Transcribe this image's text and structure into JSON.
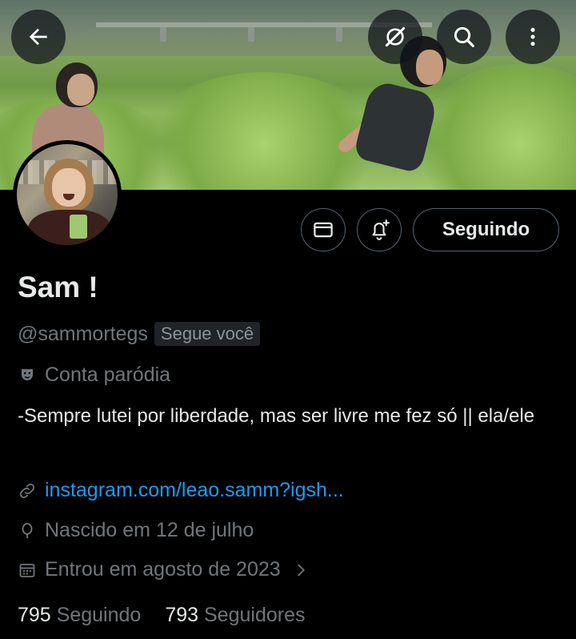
{
  "header": {
    "back_icon": "arrow-left-icon",
    "grok_icon": "grok-slash-icon",
    "search_icon": "search-icon",
    "more_icon": "more-vertical-icon"
  },
  "actions": {
    "message_icon": "envelope-icon",
    "notify_icon": "bell-plus-icon",
    "following_label": "Seguindo"
  },
  "profile": {
    "name": "Sam !",
    "handle": "@sammortegs",
    "follows_you": "Segue você",
    "parody_label": "Conta paródia",
    "bio": "-Sempre lutei por liberdade, mas ser livre me fez só || ela/ele",
    "link": "instagram.com/leao.samm?igsh...",
    "born": "Nascido em 12 de julho",
    "joined": "Entrou em agosto de 2023"
  },
  "stats": {
    "following_count": "795",
    "following_label": "Seguindo",
    "followers_count": "793",
    "followers_label": "Seguidores"
  },
  "colors": {
    "background": "#000000",
    "text_primary": "#e7e9ea",
    "text_secondary": "#71767b",
    "link": "#1d9bf0",
    "border": "#536471"
  }
}
